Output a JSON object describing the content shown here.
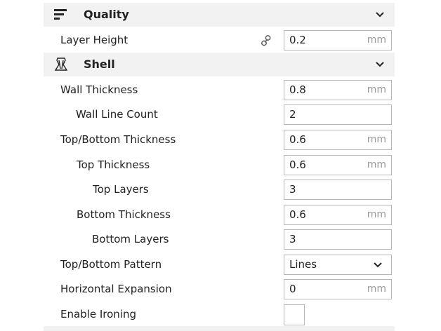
{
  "sections": {
    "quality": {
      "title": "Quality",
      "icon": "quality-bars-icon"
    },
    "shell": {
      "title": "Shell",
      "icon": "shell-vase-icon"
    }
  },
  "settings": [
    {
      "label": "Layer Height",
      "value": "0.2",
      "unit": "mm",
      "linked": true
    },
    {
      "label": "Wall Thickness",
      "value": "0.8",
      "unit": "mm"
    },
    {
      "label": "Wall Line Count",
      "value": "2"
    },
    {
      "label": "Top/Bottom Thickness",
      "value": "0.6",
      "unit": "mm"
    },
    {
      "label": "Top Thickness",
      "value": "0.6",
      "unit": "mm"
    },
    {
      "label": "Top Layers",
      "value": "3"
    },
    {
      "label": "Bottom Thickness",
      "value": "0.6",
      "unit": "mm"
    },
    {
      "label": "Bottom Layers",
      "value": "3"
    },
    {
      "label": "Top/Bottom Pattern",
      "value": "Lines",
      "type": "dropdown"
    },
    {
      "label": "Horizontal Expansion",
      "value": "0",
      "unit": "mm"
    },
    {
      "label": "Enable Ironing",
      "checked": false,
      "type": "checkbox"
    }
  ],
  "colors": {
    "header_bg": "#f2f2f2",
    "border": "#b7b7b7",
    "unit_text": "#9a9a9a"
  }
}
